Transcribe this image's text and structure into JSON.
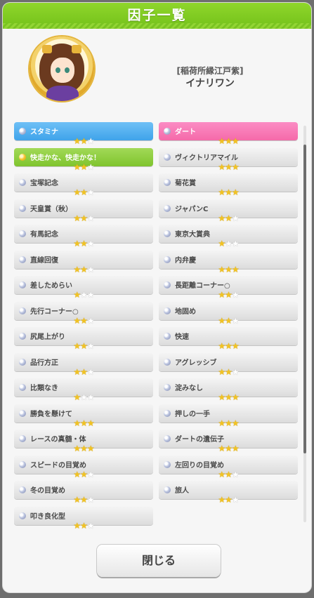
{
  "dialog": {
    "title": "因子一覧",
    "close_label": "閉じる"
  },
  "character": {
    "subtitle": "[稲荷所縁江戸紫]",
    "name": "イナリワン"
  },
  "factors_left": [
    {
      "label": "スタミナ",
      "stars": 2,
      "color": "blue"
    },
    {
      "label": "快走かな、快走かな！",
      "stars": 2,
      "color": "green"
    },
    {
      "label": "宝塚記念",
      "stars": 2,
      "color": "gray"
    },
    {
      "label": "天皇賞（秋）",
      "stars": 2,
      "color": "gray"
    },
    {
      "label": "有馬記念",
      "stars": 2,
      "color": "gray"
    },
    {
      "label": "直線回復",
      "stars": 2,
      "color": "gray"
    },
    {
      "label": "差しためらい",
      "stars": 1,
      "color": "gray"
    },
    {
      "label": "先行コーナー○",
      "stars": 2,
      "color": "gray"
    },
    {
      "label": "尻尾上がり",
      "stars": 2,
      "color": "gray"
    },
    {
      "label": "品行方正",
      "stars": 2,
      "color": "gray"
    },
    {
      "label": "比類なき",
      "stars": 1,
      "color": "gray"
    },
    {
      "label": "勝負を懸けて",
      "stars": 3,
      "color": "gray"
    },
    {
      "label": "レースの真髄・体",
      "stars": 3,
      "color": "gray"
    },
    {
      "label": "スピードの目覚め",
      "stars": 2,
      "color": "gray"
    },
    {
      "label": "冬の目覚め",
      "stars": 2,
      "color": "gray"
    },
    {
      "label": "叩き良化型",
      "stars": 2,
      "color": "gray"
    }
  ],
  "factors_right": [
    {
      "label": "ダート",
      "stars": 3,
      "color": "pink"
    },
    {
      "label": "ヴィクトリアマイル",
      "stars": 3,
      "color": "gray"
    },
    {
      "label": "菊花賞",
      "stars": 3,
      "color": "gray"
    },
    {
      "label": "ジャパンC",
      "stars": 2,
      "color": "gray"
    },
    {
      "label": "東京大賞典",
      "stars": 1,
      "color": "gray"
    },
    {
      "label": "内弁慶",
      "stars": 3,
      "color": "gray"
    },
    {
      "label": "長距離コーナー○",
      "stars": 2,
      "color": "gray"
    },
    {
      "label": "地固め",
      "stars": 2,
      "color": "gray"
    },
    {
      "label": "快速",
      "stars": 3,
      "color": "gray"
    },
    {
      "label": "アグレッシブ",
      "stars": 2,
      "color": "gray"
    },
    {
      "label": "淀みなし",
      "stars": 3,
      "color": "gray"
    },
    {
      "label": "押しの一手",
      "stars": 3,
      "color": "gray"
    },
    {
      "label": "ダートの遺伝子",
      "stars": 3,
      "color": "gray"
    },
    {
      "label": "左回りの目覚め",
      "stars": 2,
      "color": "gray"
    },
    {
      "label": "旅人",
      "stars": 2,
      "color": "gray"
    }
  ],
  "icons": {
    "factor_bullet": "orb-icon",
    "unique_factor_bullet": "gold-orb-icon",
    "star": "star-icon"
  },
  "colors": {
    "header": "#7cc820",
    "blue": "#4aa9ec",
    "pink": "#f573b0",
    "green": "#86c837",
    "star": "#f2c322"
  }
}
